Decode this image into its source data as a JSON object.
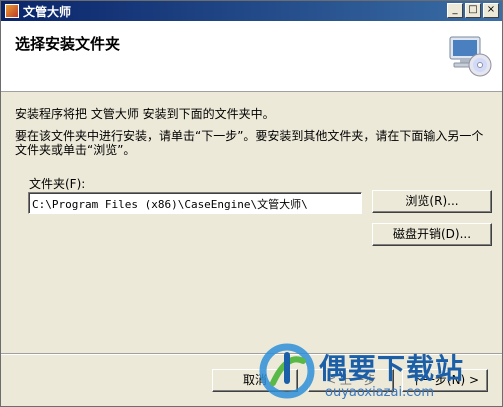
{
  "window": {
    "title": "文管大师",
    "min_label": "_",
    "max_label": "□",
    "close_label": "×"
  },
  "header": {
    "title": "选择安装文件夹"
  },
  "body": {
    "message1": "安装程序将把 文管大师 安装到下面的文件夹中。",
    "message2": "要在该文件夹中进行安装，请单击“下一步”。要安装到其他文件夹，请在下面输入另一个文件夹或单击“浏览”。",
    "folder_label": "文件夹(F):",
    "folder_path": "C:\\Program Files (x86)\\CaseEngine\\文管大师\\",
    "browse_label": "浏览(R)...",
    "disk_cost_label": "磁盘开销(D)..."
  },
  "footer": {
    "cancel_label": "取消",
    "back_label": "< 上一步",
    "next_label": "下一步(N) >"
  },
  "watermark": {
    "brand": "偶要下载站",
    "url": "ouyaoxiazai.com"
  },
  "colors": {
    "titlebar": "#0a246a",
    "dialog_bg": "#ece9d8",
    "watermark_blue": "#1b5fa8"
  }
}
